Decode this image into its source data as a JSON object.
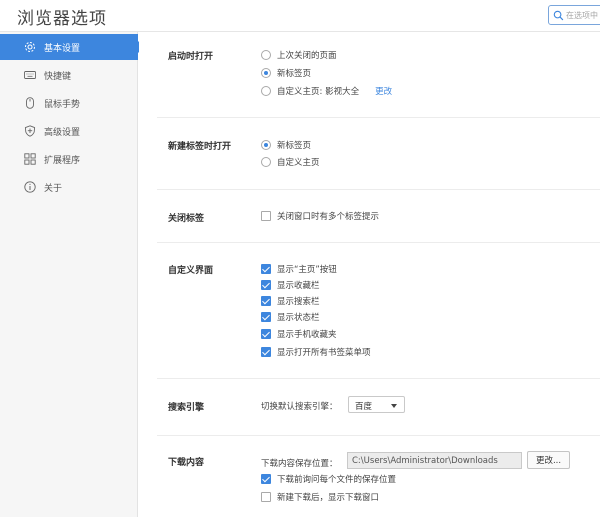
{
  "header": {
    "title": "浏览器选项",
    "search_placeholder": "在选项中"
  },
  "sidebar": {
    "items": [
      {
        "label": "基本设置",
        "icon": "gear-icon",
        "active": true
      },
      {
        "label": "快捷键",
        "icon": "keyboard-icon",
        "active": false
      },
      {
        "label": "鼠标手势",
        "icon": "mouse-icon",
        "active": false
      },
      {
        "label": "高级设置",
        "icon": "shield-icon",
        "active": false
      },
      {
        "label": "扩展程序",
        "icon": "grid-icon",
        "active": false
      },
      {
        "label": "关于",
        "icon": "info-icon",
        "active": false
      }
    ]
  },
  "startup": {
    "title": "启动时打开",
    "options": [
      {
        "label": "上次关闭的页面",
        "checked": false
      },
      {
        "label": "新标签页",
        "checked": true
      },
      {
        "label": "自定义主页: 影视大全",
        "checked": false
      }
    ],
    "change_link": "更改"
  },
  "new_tab": {
    "title": "新建标签时打开",
    "options": [
      {
        "label": "新标签页",
        "checked": true
      },
      {
        "label": "自定义主页",
        "checked": false
      }
    ]
  },
  "close_tab": {
    "title": "关闭标签",
    "options": [
      {
        "label": "关闭窗口时有多个标签提示",
        "checked": false
      }
    ]
  },
  "custom_ui": {
    "title": "自定义界面",
    "options": [
      {
        "label": "显示“主页”按钮",
        "checked": true
      },
      {
        "label": "显示收藏栏",
        "checked": true
      },
      {
        "label": "显示搜索栏",
        "checked": true
      },
      {
        "label": "显示状态栏",
        "checked": true
      },
      {
        "label": "显示手机收藏夹",
        "checked": true
      },
      {
        "label": "显示打开所有书签菜单项",
        "checked": true
      }
    ]
  },
  "search_engine": {
    "title": "搜索引擎",
    "label": "切换默认搜索引擎：",
    "selected": "百度"
  },
  "download": {
    "title": "下载内容",
    "path_label": "下载内容保存位置：",
    "path_value": "C:\\Users\\Administrator\\Downloads",
    "change_button": "更改...",
    "options": [
      {
        "label": "下载前询问每个文件的保存位置",
        "checked": true
      },
      {
        "label": "新建下载后，显示下载窗口",
        "checked": false
      }
    ]
  },
  "colors": {
    "accent": "#3d86de",
    "sidebar_bg": "#f6f6f6"
  }
}
